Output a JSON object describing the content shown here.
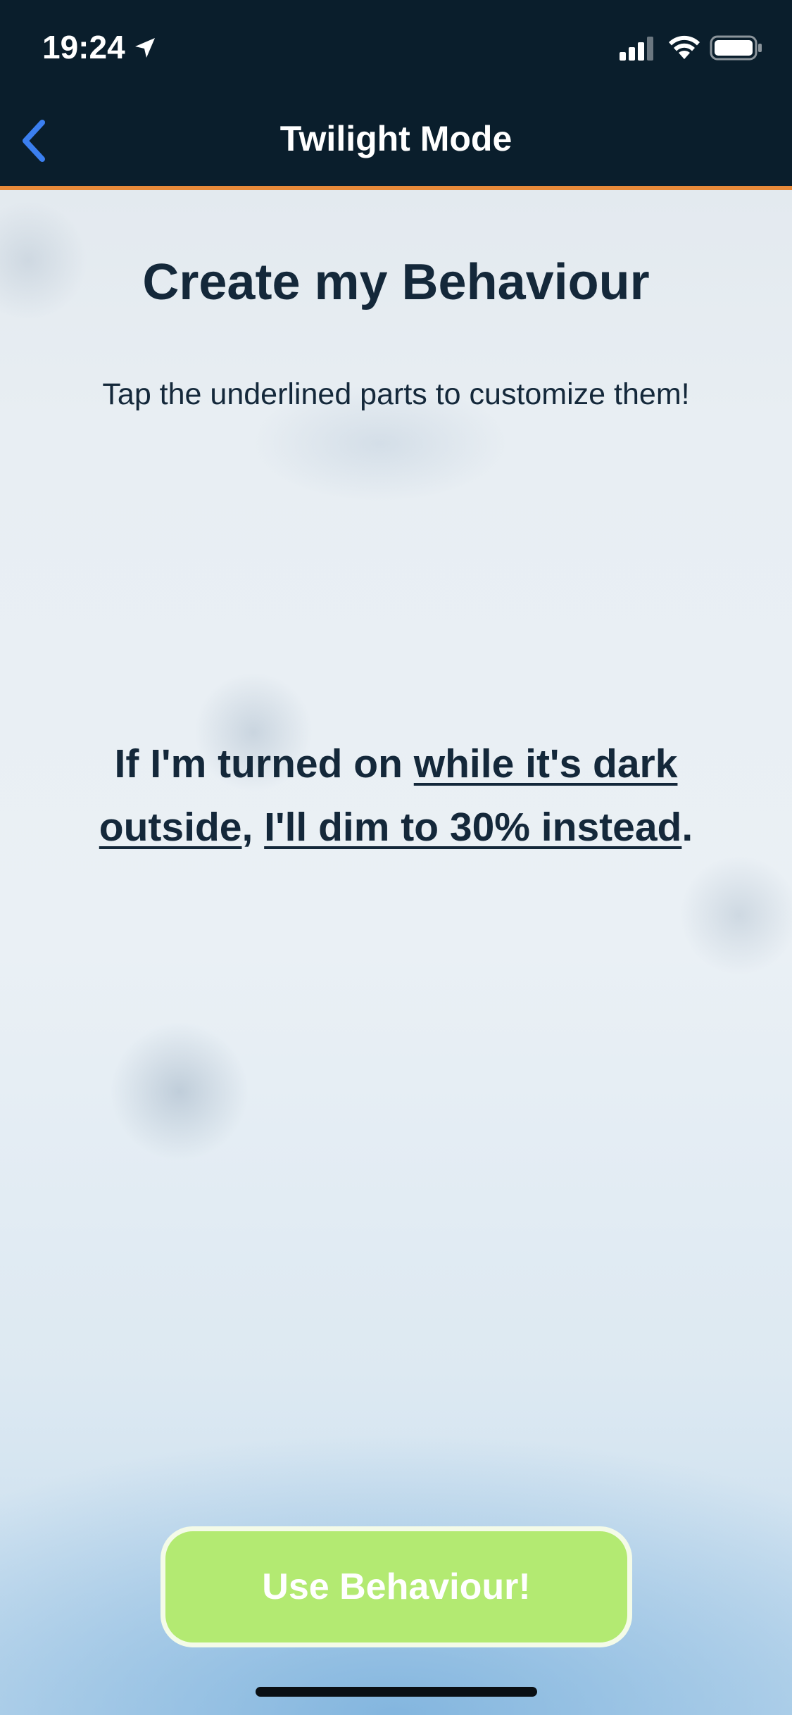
{
  "status_bar": {
    "time": "19:24",
    "icons": [
      "location-arrow-icon",
      "signal-icon",
      "wifi-icon",
      "battery-icon"
    ]
  },
  "nav": {
    "back_icon": "chevron-left-icon",
    "title": "Twilight Mode"
  },
  "content": {
    "heading": "Create my Behaviour",
    "instructions": "Tap the underlined parts to customize them!",
    "sentence": {
      "prefix": "If I'm turned on ",
      "condition_link": "while it's dark outside",
      "separator": ", ",
      "action_link": "I'll dim to 30% instead",
      "suffix": "."
    }
  },
  "footer": {
    "use_button_label": "Use Behaviour!"
  },
  "colors": {
    "nav_background": "#0a1e2c",
    "nav_accent_border": "#e88a3a",
    "back_chevron": "#3b7ff0",
    "text_dark": "#14283a",
    "button_green": "#b3ea72"
  }
}
